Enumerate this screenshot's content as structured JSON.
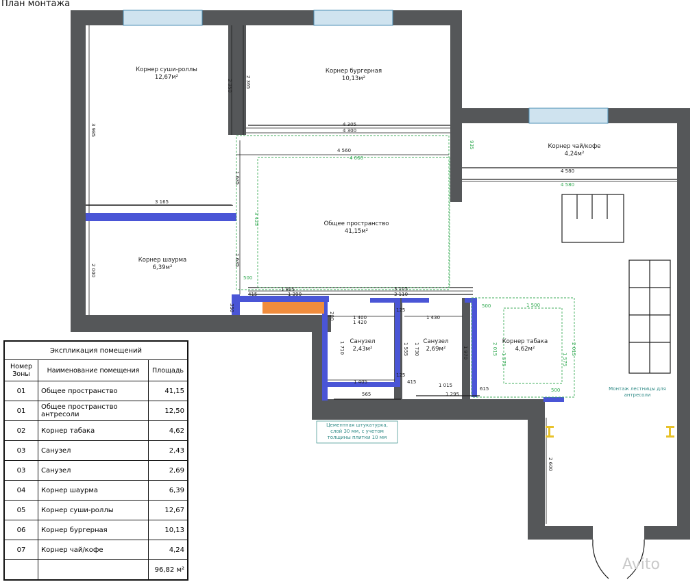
{
  "plan_title": "План монтажа",
  "rooms": {
    "sushi": {
      "name": "Корнер суши-роллы",
      "area": "12,67м²"
    },
    "burger": {
      "name": "Корнер бургерная",
      "area": "10,13м²"
    },
    "tea": {
      "name": "Корнер чай/кофе",
      "area": "4,24м²"
    },
    "common": {
      "name": "Общее пространство",
      "area": "41,15м²"
    },
    "shawarma": {
      "name": "Корнер шаурма",
      "area": "6,39м²"
    },
    "wc1": {
      "name": "Санузел",
      "area": "2,43м²"
    },
    "wc2": {
      "name": "Санузел",
      "area": "2,69м²"
    },
    "tobacco": {
      "name": "Корнер табака",
      "area": "4,62м²"
    }
  },
  "dims": {
    "d4305": "4 305",
    "d4300": "4 300",
    "d4560": "4 560",
    "d4060": "4 060",
    "d4580a": "4 580",
    "d4580b": "4 580",
    "d3165": "3 165",
    "d3985": "3 985",
    "d2350": "2 350",
    "d2365": "2 365",
    "d1635a": "1 635",
    "d1635b": "1 635",
    "d3425": "3 425",
    "d2000": "2 000",
    "d935": "935",
    "d1805": "1 805",
    "d1390": "1 390",
    "d3105": "3 105",
    "d3110": "3 110",
    "d1400": "1 400",
    "d1420": "1 420",
    "d1430": "1 430",
    "d1710": "1 710",
    "d1555": "1 555",
    "d1730": "1 730",
    "d1970": "1 970",
    "d1405": "1 405",
    "d565": "565",
    "d415a": "415",
    "d415b": "415",
    "d1015": "1 015",
    "d1295": "1 295",
    "d2015a": "2 015",
    "d2015b": "2 015",
    "d1575a": "1 575",
    "d1575b": "1 575",
    "d1500": "1 500",
    "d500a": "500",
    "d500b": "500",
    "d500c": "500",
    "d2600": "2 600",
    "d125a": "125",
    "d125b": "125",
    "d200": "200",
    "d615": "615",
    "d350": "350"
  },
  "notes": {
    "plaster": [
      "Цементная штукатурка,",
      "слой 30 мм, с учетом",
      "толщины плитки 10 мм"
    ],
    "stairs": [
      "Монтаж лестницы для",
      "антресоли"
    ]
  },
  "legend": {
    "caption": "Экспликация помещений",
    "headers": {
      "num": "Номер Зоны",
      "name": "Наименование помещения",
      "area": "Площадь"
    },
    "rows": [
      {
        "num": "01",
        "name": "Общее пространство",
        "area": "41,15"
      },
      {
        "num": "01",
        "name": "Общее пространство антресоли",
        "area": "12,50"
      },
      {
        "num": "02",
        "name": "Корнер табака",
        "area": "4,62"
      },
      {
        "num": "03",
        "name": "Санузел",
        "area": "2,43"
      },
      {
        "num": "03",
        "name": "Санузел",
        "area": "2,69"
      },
      {
        "num": "04",
        "name": "Корнер шаурма",
        "area": "6,39"
      },
      {
        "num": "05",
        "name": "Корнер суши-роллы",
        "area": "12,67"
      },
      {
        "num": "06",
        "name": "Корнер бургерная",
        "area": "10,13"
      },
      {
        "num": "07",
        "name": "Корнер чай/кофе",
        "area": "4,24"
      }
    ],
    "total": "96,82 м²"
  },
  "watermark": "Avito",
  "colors": {
    "wall": "#555759",
    "partition": "#4a55d6",
    "green_dim": "#3fae5b",
    "note": "#2f8a86"
  }
}
